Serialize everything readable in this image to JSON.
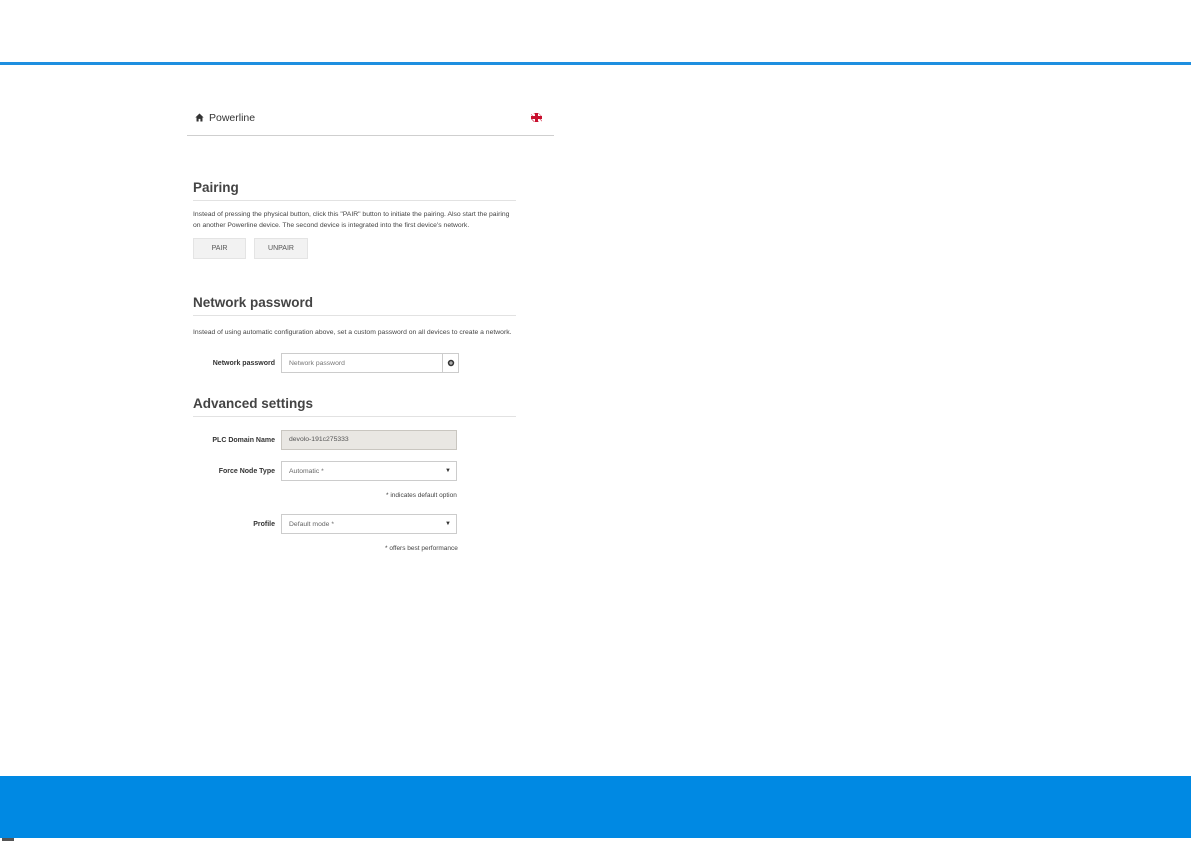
{
  "header": {
    "breadcrumb_label": "Powerline",
    "home_icon": "home-icon",
    "language_icon": "uk-flag-icon"
  },
  "pairing": {
    "title": "Pairing",
    "description": "Instead of pressing the physical button, click this \"PAIR\" button to initiate the pairing. Also start the pairing on another Powerline device. The second device is integrated into the first device's network.",
    "pair_label": "PAIR",
    "unpair_label": "UNPAIR"
  },
  "network_password": {
    "title": "Network password",
    "description": "Instead of using automatic configuration above, set a custom password on all devices to create a network.",
    "field_label": "Network password",
    "placeholder": "Network password",
    "value": "",
    "reveal_icon": "eye-icon"
  },
  "advanced": {
    "title": "Advanced settings",
    "plc_domain_label": "PLC Domain Name",
    "plc_domain_value": "devolo-191c275333",
    "force_node_label": "Force Node Type",
    "force_node_value": "Automatic *",
    "force_node_hint": "* indicates default option",
    "profile_label": "Profile",
    "profile_value": "Default mode *",
    "profile_hint": "* offers best performance"
  },
  "colors": {
    "accent": "#1e8fe0",
    "footer": "#0089e3"
  }
}
